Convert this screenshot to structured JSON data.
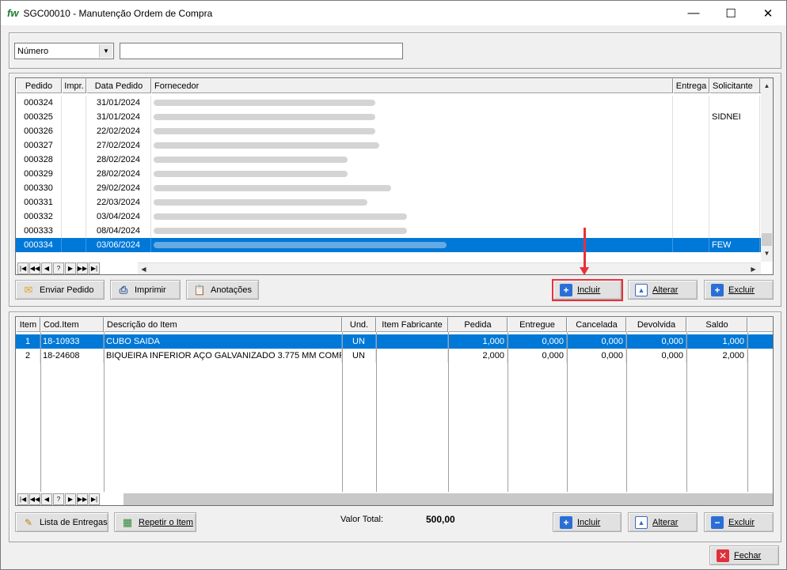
{
  "window": {
    "logo": "fw",
    "title": "SGC00010 - Manutenção Ordem de Compra",
    "minimize": "—",
    "maximize": "☐",
    "close": "✕"
  },
  "filter": {
    "field_select": "Número",
    "search_value": ""
  },
  "orders_grid": {
    "columns": [
      "Pedido",
      "Impr.",
      "Data Pedido",
      "Fornecedor",
      "Entrega",
      "Solicitante"
    ],
    "rows": [
      {
        "pedido": "000324",
        "impr": "",
        "data": "31/01/2024",
        "entrega": "",
        "solicitante": ""
      },
      {
        "pedido": "000325",
        "impr": "",
        "data": "31/01/2024",
        "entrega": "",
        "solicitante": "SIDNEI"
      },
      {
        "pedido": "000326",
        "impr": "",
        "data": "22/02/2024",
        "entrega": "",
        "solicitante": ""
      },
      {
        "pedido": "000327",
        "impr": "",
        "data": "27/02/2024",
        "entrega": "",
        "solicitante": ""
      },
      {
        "pedido": "000328",
        "impr": "",
        "data": "28/02/2024",
        "entrega": "",
        "solicitante": ""
      },
      {
        "pedido": "000329",
        "impr": "",
        "data": "28/02/2024",
        "entrega": "",
        "solicitante": ""
      },
      {
        "pedido": "000330",
        "impr": "",
        "data": "29/02/2024",
        "entrega": "",
        "solicitante": ""
      },
      {
        "pedido": "000331",
        "impr": "",
        "data": "22/03/2024",
        "entrega": "",
        "solicitante": ""
      },
      {
        "pedido": "000332",
        "impr": "",
        "data": "03/04/2024",
        "entrega": "",
        "solicitante": ""
      },
      {
        "pedido": "000333",
        "impr": "",
        "data": "08/04/2024",
        "entrega": "",
        "solicitante": ""
      },
      {
        "pedido": "000334",
        "impr": "",
        "data": "03/06/2024",
        "entrega": "",
        "solicitante": "FEW"
      }
    ]
  },
  "nav": [
    "|◀",
    "◀◀",
    "◀",
    "?",
    "▶",
    "▶▶",
    "▶|"
  ],
  "orders_buttons": {
    "enviar": "Enviar Pedido",
    "imprimir": "Imprimir",
    "anotacoes": "Anotações",
    "incluir": "Incluir",
    "alterar": "Alterar",
    "excluir": "Excluir"
  },
  "items_grid": {
    "columns": [
      "Item",
      "Cod.Item",
      "Descrição do Item",
      "Und.",
      "Item  Fabricante",
      "Pedida",
      "Entregue",
      "Cancelada",
      "Devolvida",
      "Saldo"
    ],
    "rows": [
      {
        "item": "1",
        "cod": "18-10933",
        "desc": "CUBO SAIDA",
        "und": "UN",
        "fab": "",
        "pedida": "1,000",
        "entregue": "0,000",
        "cancelada": "0,000",
        "devolvida": "0,000",
        "saldo": "1,000"
      },
      {
        "item": "2",
        "cod": "18-24608",
        "desc": "BIQUEIRA INFERIOR AÇO GALVANIZADO  3.775 MM COMP",
        "und": "UN",
        "fab": "",
        "pedida": "2,000",
        "entregue": "0,000",
        "cancelada": "0,000",
        "devolvida": "0,000",
        "saldo": "2,000"
      }
    ]
  },
  "items_buttons": {
    "lista": "Lista de Entregas",
    "repetir": "Repetir o Item",
    "incluir": "Incluir",
    "alterar": "Alterar",
    "excluir": "Excluir"
  },
  "total": {
    "label": "Valor Total:",
    "value": "500,00"
  },
  "fechar": "Fechar",
  "colors": {
    "selection": "#0078d7",
    "highlight": "#e8303a"
  }
}
